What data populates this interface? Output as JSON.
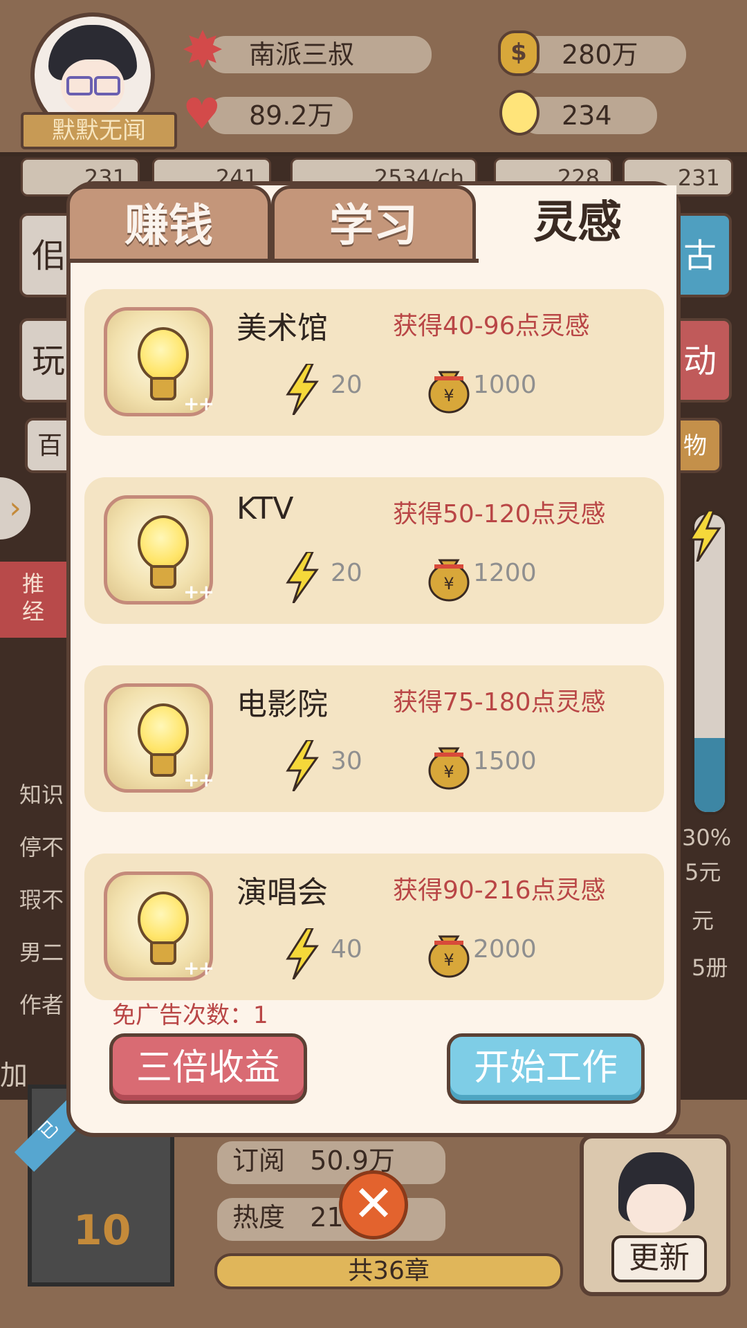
{
  "header": {
    "player_name": "默默无闻",
    "pen_name": "南派三叔",
    "money": "280万",
    "likes": "89.2万",
    "inspiration": "234"
  },
  "stats": [
    "231",
    "241",
    "2534/ch",
    "228",
    "231"
  ],
  "background": {
    "left_fragments": [
      "佀",
      "玩",
      "百"
    ],
    "left_panel_tag": [
      "推",
      "经"
    ],
    "left_lines": [
      "知识",
      "停不",
      "瑕不",
      "男二",
      "作者"
    ],
    "right_fragments": [
      "古",
      "动",
      "物"
    ],
    "right_lines": [
      "30%",
      "5元",
      "元",
      "5册"
    ],
    "overlay_left_text": "加",
    "book_tag": "已",
    "book_number": "10",
    "subscribe_label": "订阅",
    "subscribe_value": "50.9万",
    "heat_label": "热度",
    "heat_value": "214",
    "chapter_text": "共36章",
    "update_label": "更新",
    "gauge_level": 0.25
  },
  "dialog": {
    "tabs": [
      {
        "label": "赚钱",
        "active": false
      },
      {
        "label": "学习",
        "active": false
      },
      {
        "label": "灵感",
        "active": true
      }
    ],
    "items": [
      {
        "name": "美术馆",
        "reward": "获得40-96点灵感",
        "energy": "20",
        "cost": "1000"
      },
      {
        "name": "KTV",
        "reward": "获得50-120点灵感",
        "energy": "20",
        "cost": "1200"
      },
      {
        "name": "电影院",
        "reward": "获得75-180点灵感",
        "energy": "30",
        "cost": "1500"
      },
      {
        "name": "演唱会",
        "reward": "获得90-216点灵感",
        "energy": "40",
        "cost": "2000"
      }
    ],
    "plus_mark": "++",
    "ad_free_count": "免广告次数：1",
    "triple_button": "三倍收益",
    "start_button": "开始工作",
    "close_symbol": "✕"
  },
  "colors": {
    "accent_red": "#b94646",
    "button_pink": "#d96b73",
    "button_blue": "#7ecde6",
    "card_bg": "#f4e4c4"
  }
}
